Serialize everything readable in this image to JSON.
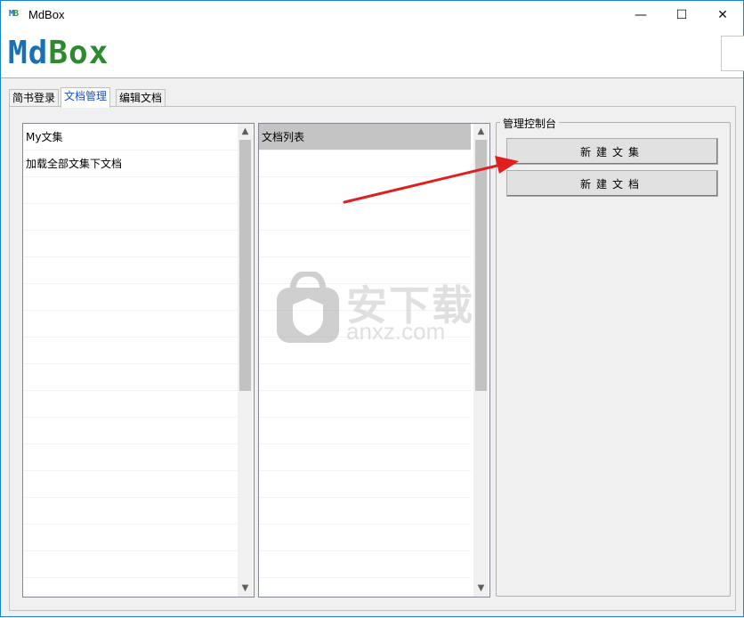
{
  "window": {
    "app_icon_m": "M",
    "app_icon_b": "B",
    "title": "MdBox",
    "min_glyph": "—",
    "max_glyph": "☐",
    "close_glyph": "✕"
  },
  "banner": {
    "logo_md": "Md",
    "logo_box": "Box"
  },
  "tabs": [
    {
      "label": "简书登录"
    },
    {
      "label": "文档管理"
    },
    {
      "label": "编辑文档"
    }
  ],
  "left_list": {
    "items": [
      "My文集",
      "加载全部文集下文档"
    ]
  },
  "right_list": {
    "items": [
      "文档列表"
    ]
  },
  "console": {
    "title": "管理控制台",
    "new_collection": "新建文集",
    "new_document": "新建文档"
  },
  "watermark": {
    "main": "安下载",
    "sub": "anxz.com"
  },
  "scroll": {
    "up": "▲",
    "down": "▼"
  },
  "colors": {
    "accent": "#1883d7",
    "tab_active": "#1d51c8",
    "arrow": "#e02020",
    "logo_blue": "#1a6fb5",
    "logo_green": "#2e8a2e"
  }
}
